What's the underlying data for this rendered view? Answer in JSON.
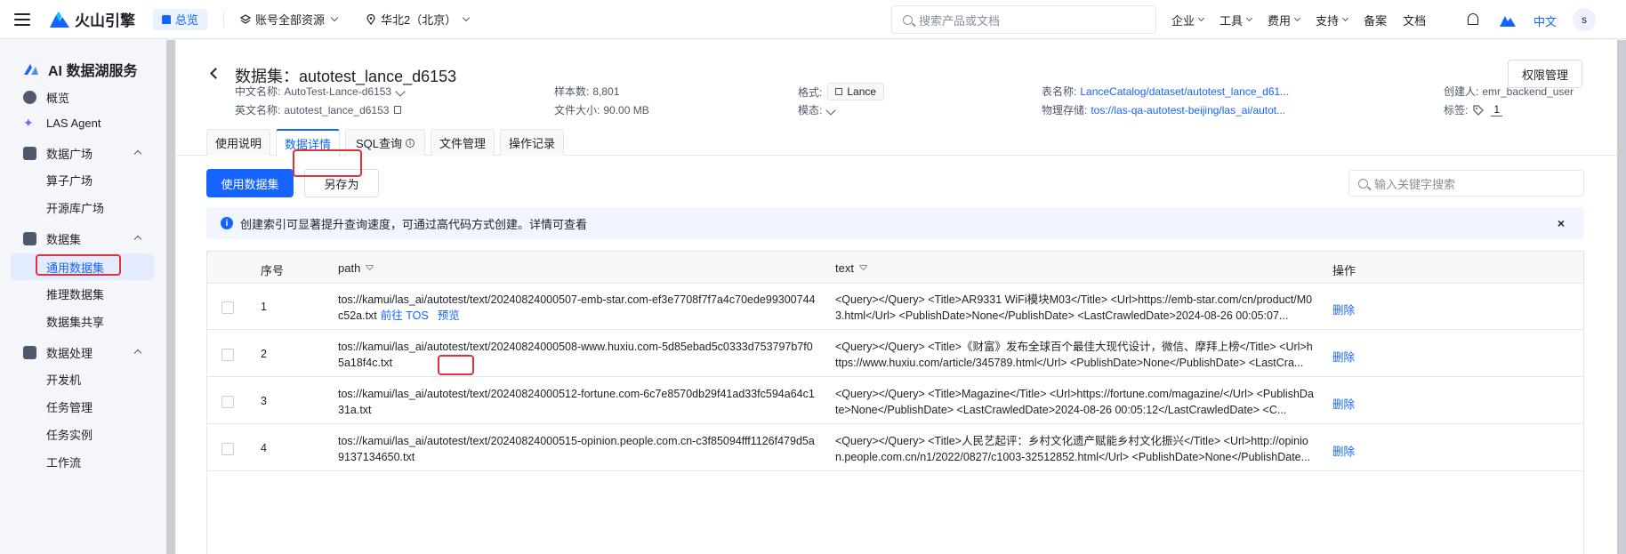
{
  "topbar": {
    "brand": "火山引擎",
    "overview": "总览",
    "account_scope": "账号全部资源",
    "region": "华北2（北京）",
    "search_placeholder": "搜索产品或文档",
    "menu": [
      "企业",
      "工具",
      "费用",
      "支持",
      "备案",
      "文档"
    ],
    "lang": "中文",
    "avatar": "s"
  },
  "sidebar": {
    "title": "AI 数据湖服务",
    "items": {
      "overview": "概览",
      "agent": "LAS Agent",
      "market": "数据广场",
      "operator_market": "算子广场",
      "opensource_market": "开源库广场",
      "datasets": "数据集",
      "general_dataset": "通用数据集",
      "inference_dataset": "推理数据集",
      "dataset_share": "数据集共享",
      "processing": "数据处理",
      "devmachine": "开发机",
      "task_mgmt": "任务管理",
      "task_instance": "任务实例",
      "workflow": "工作流"
    }
  },
  "dataset": {
    "title": "数据集：autotest_lance_d6153",
    "perm_button": "权限管理",
    "cn_name_label": "中文名称:",
    "cn_name": "AutoTest-Lance-d6153",
    "en_name_label": "英文名称:",
    "en_name": "autotest_lance_d6153",
    "samples_label": "样本数:",
    "samples": "8,801",
    "filesize_label": "文件大小:",
    "filesize": "90.00 MB",
    "format_label": "格式:",
    "format": "Lance",
    "modality_label": "模态:",
    "table_label": "表名称:",
    "table_name": "LanceCatalog/dataset/autotest_lance_d61...",
    "storage_label": "物理存储:",
    "storage": "tos://las-qa-autotest-beijing/las_ai/autot...",
    "creator_label": "创建人:",
    "creator": "emr_backend_user",
    "tags_label": "标签:",
    "tags_count": "1"
  },
  "tabs": [
    "使用说明",
    "数据详情",
    "SQL查询",
    "文件管理",
    "操作记录"
  ],
  "actions": {
    "use_dataset": "使用数据集",
    "save_as": "另存为",
    "keyword_placeholder": "输入关键字搜索"
  },
  "notice": {
    "text": "创建索引可显著提升查询速度，可通过高代码方式创建。详情可查看",
    "close": "×"
  },
  "table": {
    "headers": {
      "seq": "序号",
      "path": "path",
      "text": "text",
      "op": "操作"
    },
    "rows": [
      {
        "seq": "1",
        "path": "tos://kamui/las_ai/autotest/text/20240824000507-emb-star.com-ef3e7708f7f7a4c70ede99300744c52a.txt",
        "goto_tos": "前往 TOS",
        "preview": "预览",
        "text": "<Query></Query> <Title>AR9331 WiFi模块M03</Title> <Url>https://emb-star.com/cn/product/M03.html</Url> <PublishDate>None</PublishDate> <LastCrawledDate>2024-08-26 00:05:07...",
        "op": "删除"
      },
      {
        "seq": "2",
        "path": "tos://kamui/las_ai/autotest/text/20240824000508-www.huxiu.com-5d85ebad5c0333d753797b7f05a18f4c.txt",
        "text": "<Query></Query> <Title>《财富》发布全球百个最佳大现代设计，微信、摩拜上榜</Title> <Url>https://www.huxiu.com/article/345789.html</Url> <PublishDate>None</PublishDate> <LastCra...",
        "op": "删除"
      },
      {
        "seq": "3",
        "path": "tos://kamui/las_ai/autotest/text/20240824000512-fortune.com-6c7e8570db29f41ad33fc594a64c131a.txt",
        "text": "<Query></Query> <Title>Magazine</Title> <Url>https://fortune.com/magazine/</Url> <PublishDate>None</PublishDate> <LastCrawledDate>2024-08-26 00:05:12</LastCrawledDate> <C...",
        "op": "删除"
      },
      {
        "seq": "4",
        "path": "tos://kamui/las_ai/autotest/text/20240824000515-opinion.people.com.cn-c3f85094fff1126f479d5a9137134650.txt",
        "text": "<Query></Query> <Title>人民艺起评：乡村文化遗产赋能乡村文化振兴</Title> <Url>http://opinion.people.com.cn/n1/2022/0827/c1003-32512852.html</Url> <PublishDate>None</PublishDate...",
        "op": "删除"
      }
    ]
  },
  "colors": {
    "accent": "#1664ff",
    "highlight": "#e0303a",
    "sidebar_bg": "#f4f6f9"
  }
}
